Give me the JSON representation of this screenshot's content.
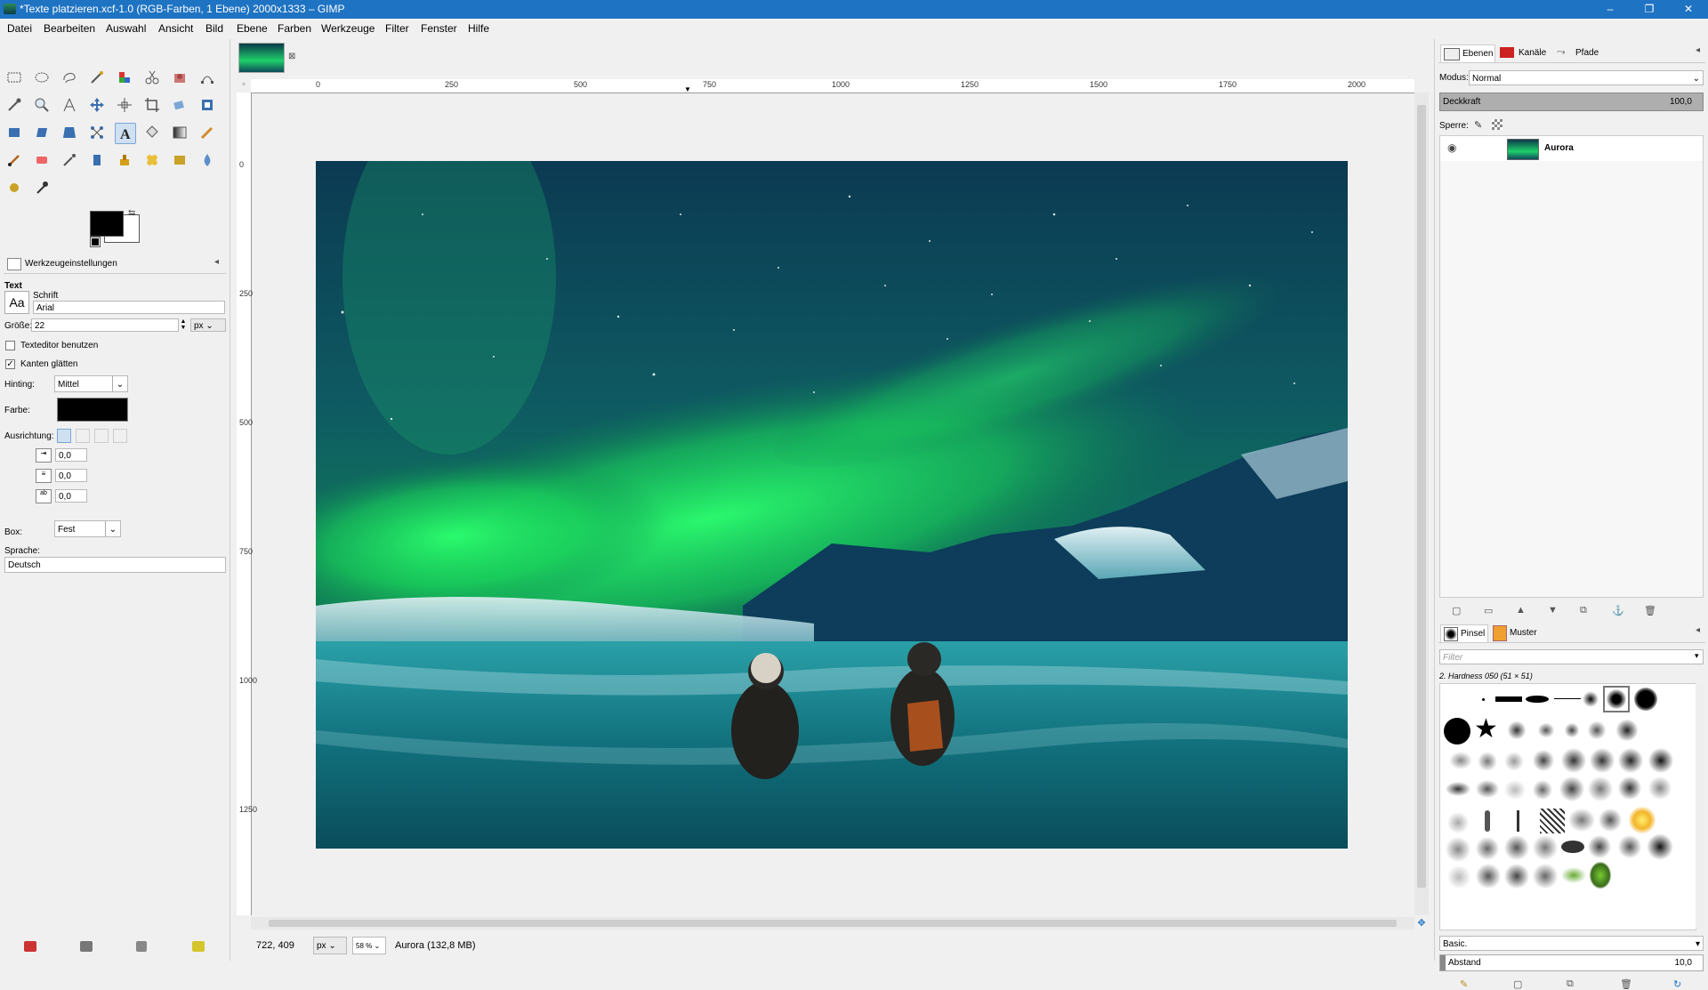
{
  "window": {
    "title": "*Texte platzieren.xcf-1.0 (RGB-Farben, 1 Ebene) 2000x1333 – GIMP",
    "controls": [
      "–",
      "❐",
      "✕"
    ]
  },
  "menu": [
    "Datei",
    "Bearbeiten",
    "Auswahl",
    "Ansicht",
    "Bild",
    "Ebene",
    "Farben",
    "Werkzeuge",
    "Filter",
    "Fenster",
    "Hilfe"
  ],
  "tool_options": {
    "panel_title": "Werkzeugeinstellungen",
    "tool_name": "Text",
    "font_label": "Schrift",
    "font_preview": "Aa",
    "font_value": "Arial",
    "size_label": "Größe:",
    "size_value": "22",
    "size_unit": "px",
    "use_editor_label": "Texteditor benutzen",
    "use_editor_checked": false,
    "antialias_label": "Kanten glätten",
    "antialias_checked": true,
    "hinting_label": "Hinting:",
    "hinting_value": "Mittel",
    "color_label": "Farbe:",
    "color_value": "#000000",
    "justify_label": "Ausrichtung:",
    "indent_value": "0,0",
    "line_spacing_value": "0,0",
    "letter_spacing_value": "0,0",
    "box_label": "Box:",
    "box_value": "Fest",
    "language_label": "Sprache:",
    "language_value": "Deutsch"
  },
  "ruler": {
    "top_ticks": [
      "0",
      "250",
      "500",
      "750",
      "1000",
      "1250",
      "1500",
      "1750",
      "2000"
    ],
    "left_ticks": [
      "0",
      "250",
      "500",
      "750",
      "1000",
      "1250"
    ]
  },
  "status": {
    "coords": "722, 409",
    "unit": "px",
    "zoom": "58 %",
    "info": "Aurora (132,8 MB)"
  },
  "layers_panel": {
    "tabs": [
      "Ebenen",
      "Kanäle",
      "Pfade"
    ],
    "mode_label": "Modus:",
    "mode_value": "Normal",
    "opacity_label": "Deckkraft",
    "opacity_value": "100,0",
    "lock_label": "Sperre:",
    "layer_name": "Aurora"
  },
  "brushes_panel": {
    "tabs": [
      "Pinsel",
      "Muster"
    ],
    "filter_placeholder": "Filter",
    "brush_name": "2. Hardness 050 (51 × 51)",
    "preset_value": "Basic.",
    "spacing_label": "Abstand",
    "spacing_value": "10,0"
  },
  "colors": {
    "titlebar": "#1e73c2",
    "foreground": "#000000",
    "background": "#ffffff",
    "accent": "#3c8fd9"
  }
}
